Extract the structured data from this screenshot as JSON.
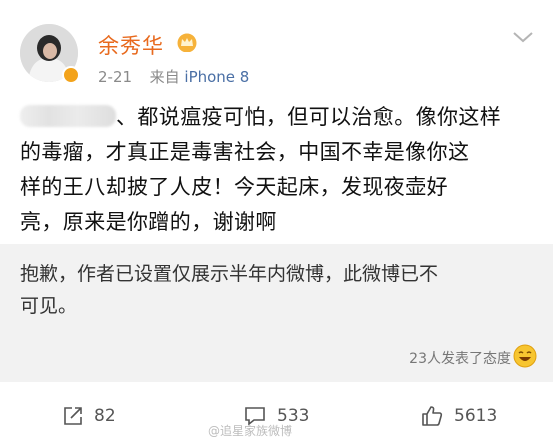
{
  "post": {
    "username": "余秀华",
    "date": "2-21",
    "source_prefix": "来自",
    "device": "iPhone 8",
    "content_lines": [
      "、都说瘟疫可怕，但可以治愈。像你这样",
      "的毒瘤，才真正是毒害社会，中国不幸是像你这",
      "样的王八却披了人皮！今天起床，发现夜壶好",
      "亮，原来是你蹭的，谢谢啊"
    ]
  },
  "notice": {
    "lines": [
      "抱歉，作者已设置仅展示半年内微博，此微博已不",
      "可见。"
    ],
    "reactions_text": "23人发表了态度"
  },
  "actions": {
    "repost_count": "82",
    "comment_count": "533",
    "like_count": "5613"
  },
  "watermark": "@追星家族微博",
  "colors": {
    "username": "#e86a1e",
    "verified": "#f3a31b",
    "device_link": "#4a6fa5",
    "notice_bg": "#f2f2f2"
  },
  "icons": {
    "crown": "crown-icon",
    "chevron": "chevron-down-icon",
    "repost": "repost-icon",
    "comment": "comment-icon",
    "like": "thumbs-up-icon",
    "reaction": "smile-emoji-icon"
  }
}
